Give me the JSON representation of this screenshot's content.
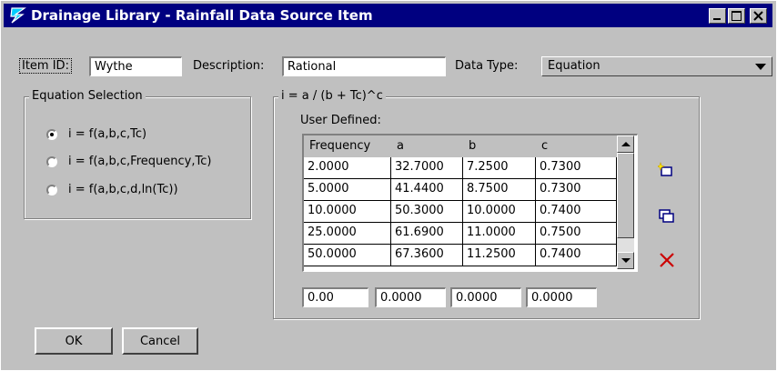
{
  "window": {
    "title": "Drainage Library - Rainfall Data Source Item"
  },
  "form": {
    "item_id_label": "Item ID:",
    "item_id_value": "Wythe",
    "description_label": "Description:",
    "description_value": "Rational",
    "data_type_label": "Data Type:",
    "data_type_value": "Equation"
  },
  "equation_selection": {
    "title": "Equation Selection",
    "options": [
      {
        "label": "i = f(a,b,c,Tc)",
        "selected": true
      },
      {
        "label": "i = f(a,b,c,Frequency,Tc)",
        "selected": false
      },
      {
        "label": "i = f(a,b,c,d,ln(Tc))",
        "selected": false
      }
    ]
  },
  "coefficients": {
    "title": "i = a / (b + Tc)^c",
    "user_defined_label": "User Defined:",
    "columns": [
      "Frequency",
      "a",
      "b",
      "c"
    ],
    "rows": [
      [
        "2.0000",
        "32.7000",
        "7.2500",
        "0.7300"
      ],
      [
        "5.0000",
        "41.4400",
        "8.7500",
        "0.7300"
      ],
      [
        "10.0000",
        "50.3000",
        "10.0000",
        "0.7400"
      ],
      [
        "25.0000",
        "61.6900",
        "11.0000",
        "0.7500"
      ],
      [
        "50.0000",
        "67.3600",
        "11.2500",
        "0.7400"
      ]
    ],
    "edit_values": [
      "0.00",
      "0.0000",
      "0.0000",
      "0.0000"
    ]
  },
  "icons": {
    "title_icon": "bentley-b-icon",
    "add": "add-row-icon",
    "duplicate": "duplicate-row-icon",
    "delete": "delete-row-icon",
    "delete_color": "#cc0000"
  },
  "buttons": {
    "ok": "OK",
    "cancel": "Cancel"
  }
}
